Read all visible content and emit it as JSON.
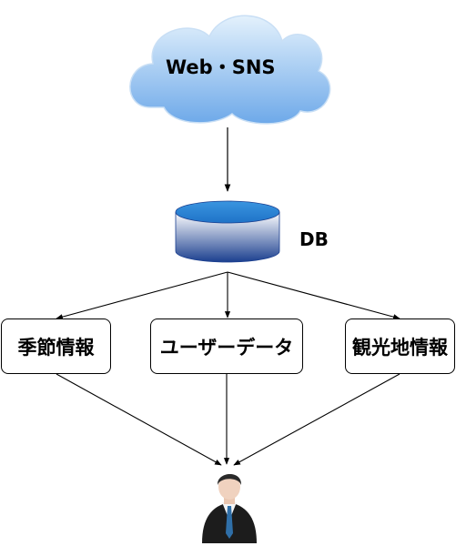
{
  "cloud": {
    "label": "Web・SNS"
  },
  "database": {
    "label": "DB"
  },
  "boxes": {
    "seasonal": "季節情報",
    "user_data": "ユーザーデータ",
    "tourism": "観光地情報"
  },
  "colors": {
    "cloud_top": "#dcedfb",
    "cloud_bottom": "#6aa8e8",
    "db_top": "#2f88d8",
    "db_side_dark": "#1b3f8f",
    "db_side_light": "#ffffff",
    "line": "#000000"
  },
  "icons": {
    "person": "businessman-icon"
  }
}
